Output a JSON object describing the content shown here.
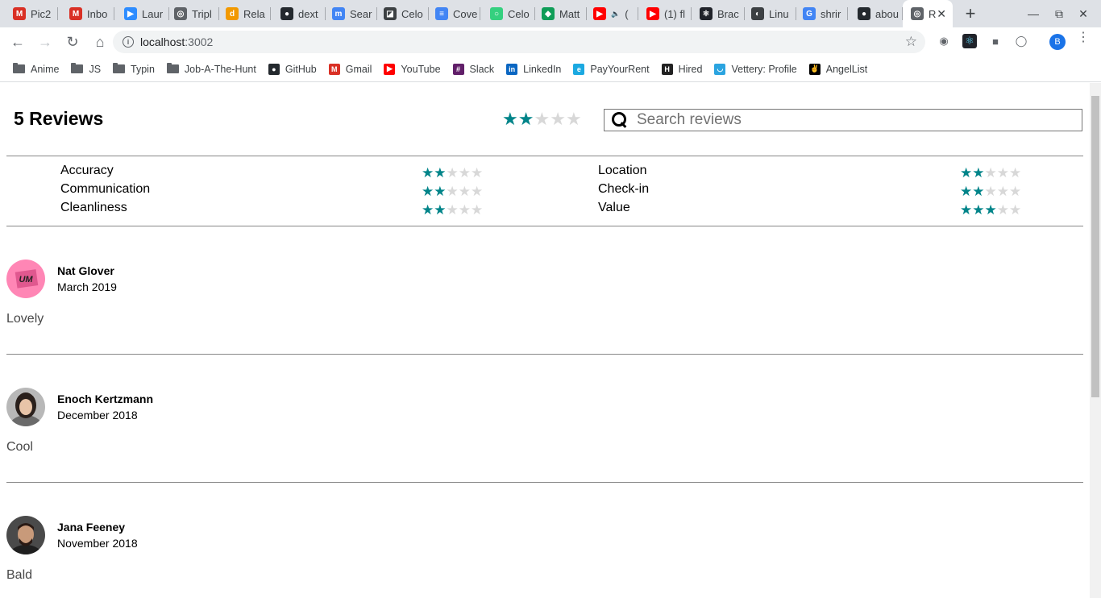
{
  "browser": {
    "tabs": [
      {
        "title": "Pic2",
        "icon": "gmail-icon",
        "color": "#d93025",
        "glyph": "M"
      },
      {
        "title": "Inbo",
        "icon": "gmail-icon",
        "color": "#d93025",
        "glyph": "M"
      },
      {
        "title": "Laur",
        "icon": "zoom-icon",
        "color": "#2d8cff",
        "glyph": "▶"
      },
      {
        "title": "Tripl",
        "icon": "globe-icon",
        "color": "#5f6368",
        "glyph": "◎"
      },
      {
        "title": "Rela",
        "icon": "d-icon",
        "color": "#f29900",
        "glyph": "d"
      },
      {
        "title": "dext",
        "icon": "github-icon",
        "color": "#24292e",
        "glyph": "●"
      },
      {
        "title": "Sear",
        "icon": "search-site-icon",
        "color": "#4285f4",
        "glyph": "m"
      },
      {
        "title": "Celo",
        "icon": "celo-icon",
        "color": "#3c4043",
        "glyph": "◪"
      },
      {
        "title": "Cove",
        "icon": "docs-icon",
        "color": "#4285f4",
        "glyph": "≡"
      },
      {
        "title": "Celo",
        "icon": "celo-ring-icon",
        "color": "#35d07f",
        "glyph": "○"
      },
      {
        "title": "Matt",
        "icon": "chat-icon",
        "color": "#0f9d58",
        "glyph": "◆"
      },
      {
        "title": "(",
        "icon": "youtube-icon",
        "color": "#ff0000",
        "glyph": "▶",
        "audio": true
      },
      {
        "title": "(1) fl",
        "icon": "youtube-icon",
        "color": "#ff0000",
        "glyph": "▶"
      },
      {
        "title": "Brac",
        "icon": "react-icon",
        "color": "#20232a",
        "glyph": "⚛"
      },
      {
        "title": "Linu",
        "icon": "linux-icon",
        "color": "#3c4043",
        "glyph": "◐"
      },
      {
        "title": "shrir",
        "icon": "google-icon",
        "color": "#4285f4",
        "glyph": "G"
      },
      {
        "title": "abou",
        "icon": "github-icon",
        "color": "#24292e",
        "glyph": "●"
      },
      {
        "title": "R",
        "icon": "globe-icon",
        "color": "#5f6368",
        "glyph": "◎",
        "active": true
      }
    ],
    "url_host": "localhost",
    "url_port": ":3002",
    "profile_initial": "B",
    "bookmarks": [
      {
        "label": "Anime",
        "type": "folder"
      },
      {
        "label": "JS",
        "type": "folder"
      },
      {
        "label": "Typin",
        "type": "folder"
      },
      {
        "label": "Job-A-The-Hunt",
        "type": "folder"
      },
      {
        "label": "GitHub",
        "type": "site",
        "icon": "github-icon",
        "color": "#24292e",
        "glyph": "●"
      },
      {
        "label": "Gmail",
        "type": "site",
        "icon": "gmail-icon",
        "color": "#d93025",
        "glyph": "M"
      },
      {
        "label": "YouTube",
        "type": "site",
        "icon": "youtube-icon",
        "color": "#ff0000",
        "glyph": "▶"
      },
      {
        "label": "Slack",
        "type": "site",
        "icon": "slack-icon",
        "color": "#611f69",
        "glyph": "#"
      },
      {
        "label": "LinkedIn",
        "type": "site",
        "icon": "linkedin-icon",
        "color": "#0a66c2",
        "glyph": "in"
      },
      {
        "label": "PayYourRent",
        "type": "site",
        "icon": "payyourrent-icon",
        "color": "#1ba9e1",
        "glyph": "e"
      },
      {
        "label": "Hired",
        "type": "site",
        "icon": "hired-icon",
        "color": "#222222",
        "glyph": "H"
      },
      {
        "label": "Vettery: Profile",
        "type": "site",
        "icon": "vettery-icon",
        "color": "#2ba4e0",
        "glyph": "◡"
      },
      {
        "label": "AngelList",
        "type": "site",
        "icon": "angellist-icon",
        "color": "#000000",
        "glyph": "✌"
      }
    ]
  },
  "reviews": {
    "heading": "5 Reviews",
    "overall_rating": 2,
    "max_rating": 5,
    "search_placeholder": "Search reviews",
    "accent_color": "#008489",
    "categories_left": [
      {
        "label": "Accuracy",
        "rating": 2
      },
      {
        "label": "Communication",
        "rating": 2
      },
      {
        "label": "Cleanliness",
        "rating": 2
      }
    ],
    "categories_right": [
      {
        "label": "Location",
        "rating": 2
      },
      {
        "label": "Check-in",
        "rating": 2
      },
      {
        "label": "Value",
        "rating": 3
      }
    ],
    "items": [
      {
        "name": "Nat Glover",
        "date": "March 2019",
        "body": "Lovely",
        "avatar": "um-logo-avatar"
      },
      {
        "name": "Enoch Kertzmann",
        "date": "December 2018",
        "body": "Cool",
        "avatar": "woman-photo-avatar"
      },
      {
        "name": "Jana Feeney",
        "date": "November 2018",
        "body": "Bald",
        "avatar": "man-photo-avatar"
      }
    ]
  }
}
